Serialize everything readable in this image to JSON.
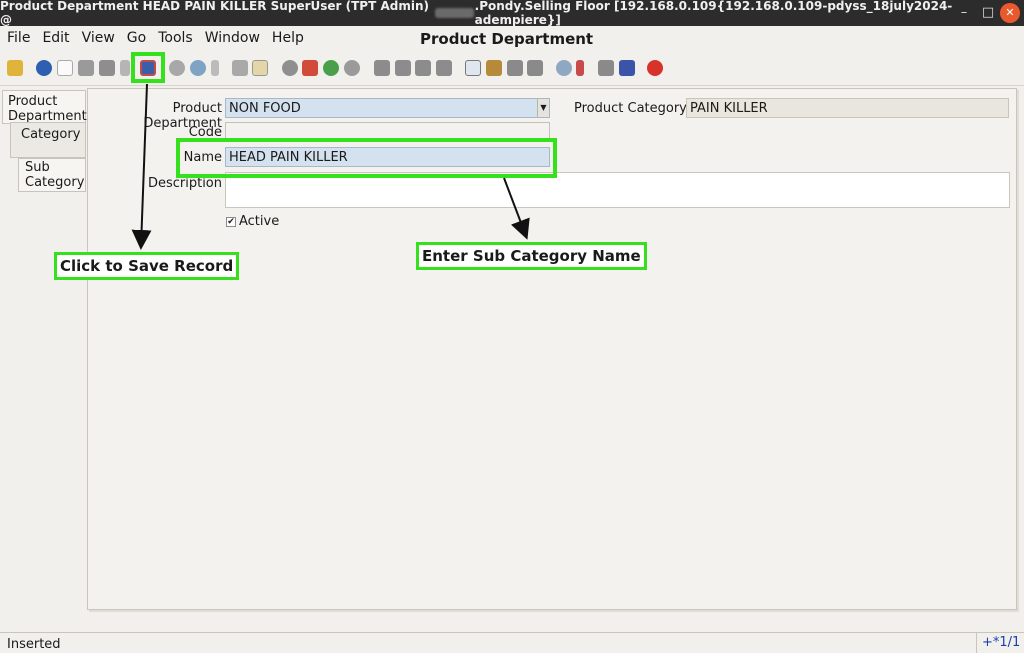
{
  "titlebar": {
    "text_before": "Product Department  HEAD PAIN KILLER  SuperUser (TPT Admin) @",
    "text_after": ".Pondy.Selling Floor [192.168.0.109{192.168.0.109-pdyss_18july2024-adempiere}]"
  },
  "menu": [
    "File",
    "Edit",
    "View",
    "Go",
    "Tools",
    "Window",
    "Help"
  ],
  "window_title": "Product Department",
  "tabs": {
    "product_department": "Product Department",
    "category": "Category",
    "sub_category": "Sub Category"
  },
  "form": {
    "product_department_label": "Product Department",
    "product_department_value": "NON FOOD",
    "product_category_label": "Product Category",
    "product_category_value": "PAIN KILLER",
    "code_label": "Code",
    "code_value": "",
    "name_label": "Name",
    "name_value": "HEAD PAIN KILLER",
    "description_label": "Description",
    "description_value": "",
    "active_label": "Active",
    "active_checked": true
  },
  "annotations": {
    "save": "Click to Save Record",
    "name": "Enter Sub Category Name"
  },
  "status": {
    "text": "Inserted",
    "record": "+*1/1"
  },
  "colors": {
    "highlight": "#35e01c",
    "field_bg": "#d4e1ef"
  }
}
